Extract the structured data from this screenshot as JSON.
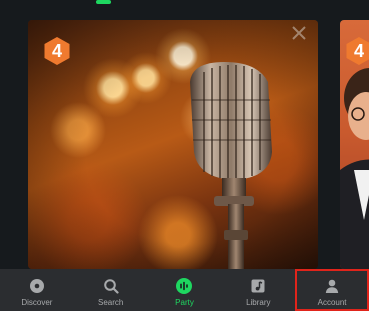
{
  "cards": [
    {
      "rank": "4",
      "image": "vintage-microphone-bokeh"
    },
    {
      "rank": "4",
      "image": "person-portrait"
    }
  ],
  "bottom_nav": {
    "items": [
      {
        "label": "Discover",
        "icon": "disc-icon"
      },
      {
        "label": "Search",
        "icon": "search-icon"
      },
      {
        "label": "Party",
        "icon": "party-equalizer-icon",
        "active": true
      },
      {
        "label": "Library",
        "icon": "library-icon"
      },
      {
        "label": "Account",
        "icon": "account-icon",
        "highlighted": true
      }
    ]
  },
  "colors": {
    "background": "#161a1d",
    "nav_background": "#2b2d30",
    "accent": "#1ed760",
    "badge": "#ef7a2f",
    "highlight_box": "#e0241b"
  }
}
